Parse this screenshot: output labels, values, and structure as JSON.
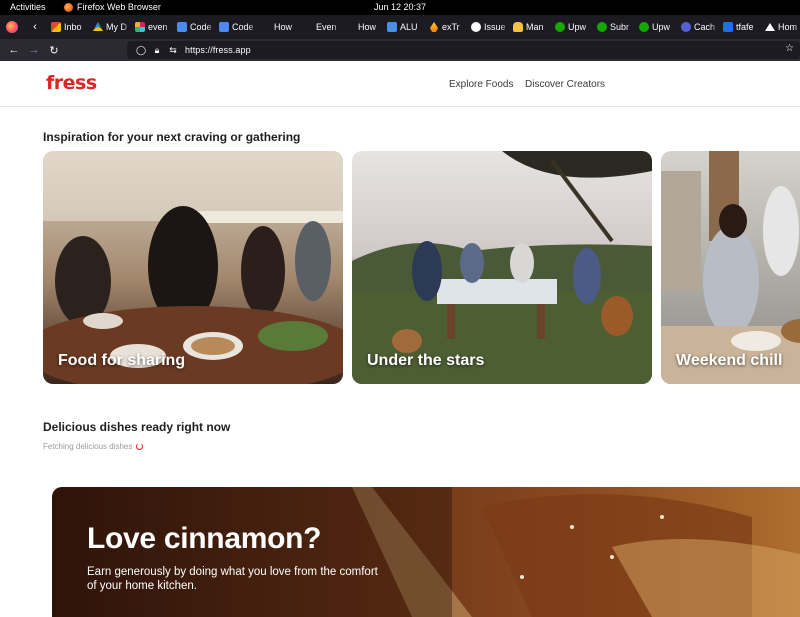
{
  "os": {
    "activities": "Activities",
    "app_name": "Firefox Web Browser",
    "clock": "Jun 12  20:37"
  },
  "tabs": [
    {
      "label": "Inbo",
      "icon": "gmail-icon"
    },
    {
      "label": "My D",
      "icon": "drive-icon"
    },
    {
      "label": "even",
      "icon": "slack-icon"
    },
    {
      "label": "Code",
      "icon": "docs-icon"
    },
    {
      "label": "Code",
      "icon": "docs-icon"
    },
    {
      "label": "How",
      "icon": "pen-icon"
    },
    {
      "label": "Even",
      "icon": "pen-icon"
    },
    {
      "label": "How",
      "icon": "pen-icon"
    },
    {
      "label": "ALU",
      "icon": "alu-icon"
    },
    {
      "label": "exTr",
      "icon": "firebase-icon"
    },
    {
      "label": "Issue",
      "icon": "github-icon"
    },
    {
      "label": "Man",
      "icon": "hand-icon"
    },
    {
      "label": "Upw",
      "icon": "upwork-icon"
    },
    {
      "label": "Subr",
      "icon": "upwork-icon"
    },
    {
      "label": "Upw",
      "icon": "upwork-icon"
    },
    {
      "label": "Cach",
      "icon": "cache-icon"
    },
    {
      "label": "tfafe",
      "icon": "tf-icon"
    },
    {
      "label": "Hom",
      "icon": "home-icon"
    }
  ],
  "address_bar": {
    "url": "https://fress.app"
  },
  "site": {
    "logo": "fress",
    "nav": {
      "explore": "Explore Foods",
      "discover": "Discover Creators"
    },
    "inspiration_title": "Inspiration for your next craving or gathering",
    "cards": [
      {
        "title": "Food for sharing"
      },
      {
        "title": "Under the stars"
      },
      {
        "title": "Weekend chill"
      }
    ],
    "dishes_title": "Delicious dishes ready right now",
    "loading_text": "Fetching delicious dishes",
    "promo": {
      "title": "Love cinnamon?",
      "text": "Earn generously by doing what you love from the comfort of your home kitchen."
    }
  },
  "colors": {
    "brand": "#e02424",
    "browser_tabbar": "#1c1b22",
    "browser_navbar": "#2b2a33"
  }
}
